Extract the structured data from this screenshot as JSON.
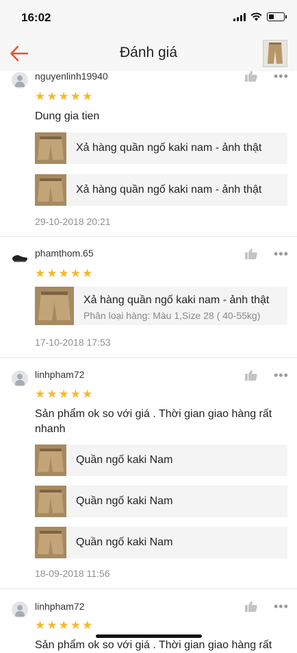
{
  "status_bar": {
    "time": "16:02"
  },
  "header": {
    "title": "Đánh giá"
  },
  "reviews": [
    {
      "username": "nguyenlinh19940",
      "rating": 5,
      "text": "Dung gia tien",
      "products": [
        {
          "name": "Xả hàng quần ngố kaki nam - ảnh thật"
        },
        {
          "name": "Xả hàng quần ngố kaki nam - ảnh thật"
        }
      ],
      "timestamp": "29-10-2018 20:21"
    },
    {
      "username": "phamthom.65",
      "rating": 5,
      "products": [
        {
          "name": "Xả hàng quần ngố kaki nam - ảnh thật",
          "variant": "Phân loại hàng: Màu 1,Size 28 ( 40-55kg)"
        }
      ],
      "timestamp": "17-10-2018 17:53"
    },
    {
      "username": "linhpham72",
      "rating": 5,
      "text": "Sản phẩm ok so với giá .  Thời gian giao hàng rất nhanh",
      "products": [
        {
          "name": "Quần ngố kaki Nam"
        },
        {
          "name": "Quần ngố kaki Nam"
        },
        {
          "name": "Quần ngố kaki Nam"
        }
      ],
      "timestamp": "18-09-2018 11:56"
    },
    {
      "username": "linhpham72",
      "rating": 5,
      "text": "Sản phẩm ok so với giá .  Thời gian giao hàng rất"
    }
  ]
}
